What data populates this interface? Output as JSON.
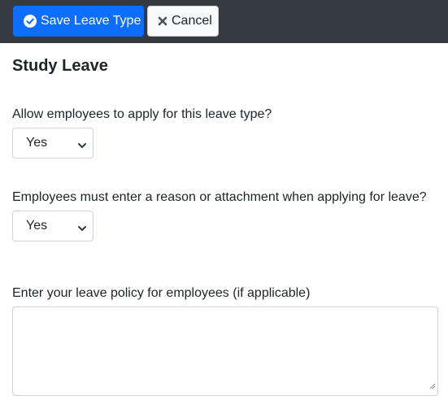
{
  "toolbar": {
    "save_label": "Save Leave Type",
    "cancel_label": "Cancel",
    "save_icon": "check-circle-icon",
    "cancel_icon": "times-icon",
    "colors": {
      "bar": "#343a40",
      "primary": "#0d6efd",
      "secondary": "#f8f9fa"
    }
  },
  "page": {
    "title": "Study Leave"
  },
  "form": {
    "allow_apply": {
      "label": "Allow employees to apply for this leave type?",
      "value": "Yes"
    },
    "reason_required": {
      "label": "Employees must enter a reason or attachment when applying for leave?",
      "value": "Yes"
    },
    "policy": {
      "label": "Enter your leave policy for employees (if applicable)",
      "value": ""
    }
  }
}
